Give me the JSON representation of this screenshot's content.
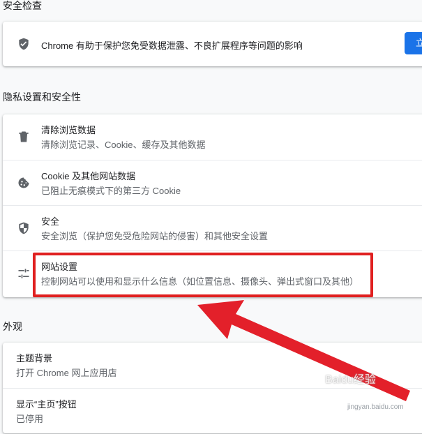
{
  "safety_check": {
    "title": "安全检查",
    "description": "Chrome 有助于保护您免受数据泄露、不良扩展程序等问题的影响",
    "button_label": "立"
  },
  "privacy": {
    "title": "隐私设置和安全性",
    "items": [
      {
        "icon": "trash-icon",
        "label": "清除浏览数据",
        "sub": "清除浏览记录、Cookie、缓存及其他数据"
      },
      {
        "icon": "cookie-icon",
        "label": "Cookie 及其他网站数据",
        "sub": "已阻止无痕模式下的第三方 Cookie"
      },
      {
        "icon": "security-shield-icon",
        "label": "安全",
        "sub": "安全浏览（保护您免受危险网站的侵害）和其他安全设置"
      },
      {
        "icon": "tune-sliders-icon",
        "label": "网站设置",
        "sub": "控制网站可以使用和显示什么信息（如位置信息、摄像头、弹出式窗口及其他）"
      }
    ]
  },
  "appearance": {
    "title": "外观",
    "items": [
      {
        "label": "主题背景",
        "sub": "打开 Chrome 网上应用店"
      },
      {
        "label": "显示“主页”按钮",
        "sub": "已停用"
      }
    ]
  },
  "annotation": {
    "highlight_color": "#e02020",
    "arrow_color": "#e3202a"
  },
  "watermark": {
    "text": "Baidu经验",
    "sub": "jingyan.baidu.com"
  }
}
